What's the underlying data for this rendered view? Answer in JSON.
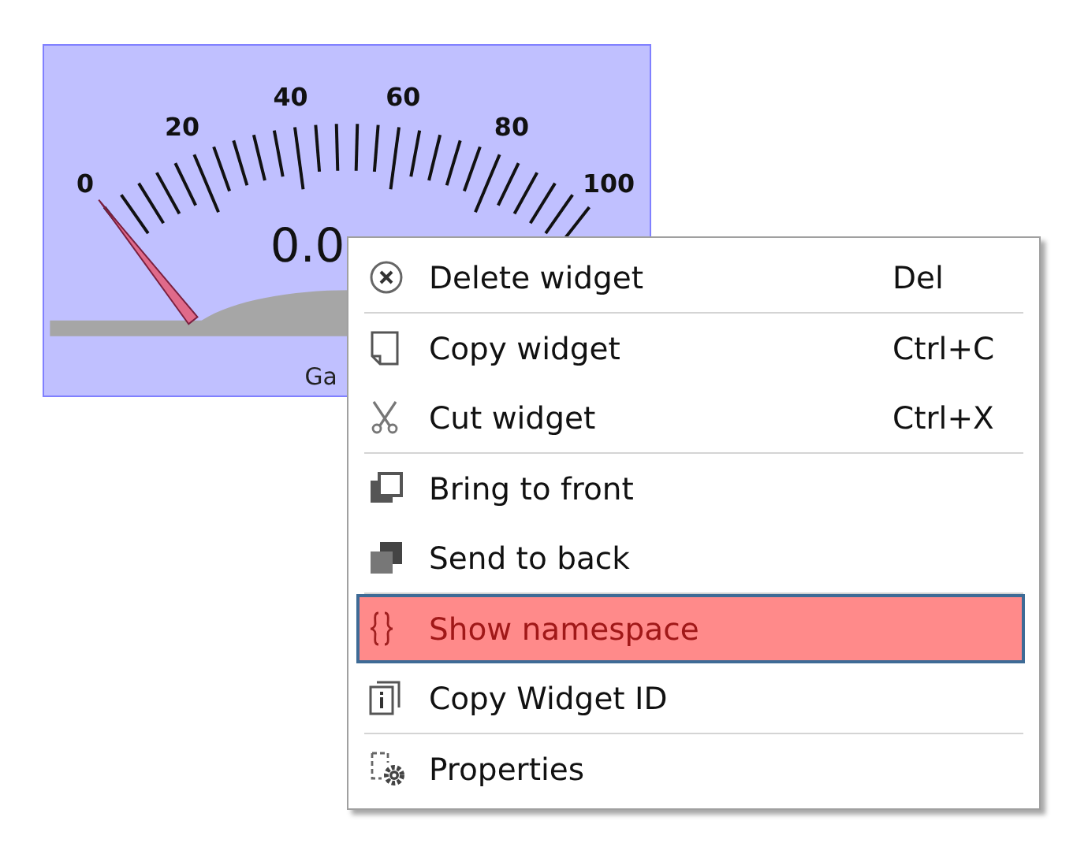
{
  "gauge": {
    "scale_labels": [
      "0",
      "20",
      "40",
      "60",
      "80",
      "100"
    ],
    "value": "0.0",
    "label": "Ga"
  },
  "context_menu": {
    "items": [
      {
        "kind": "item",
        "label": "Delete widget",
        "shortcut": "Del",
        "selected": false
      },
      {
        "kind": "separator"
      },
      {
        "kind": "item",
        "label": "Copy widget",
        "shortcut": "Ctrl+C",
        "selected": false
      },
      {
        "kind": "item",
        "label": "Cut widget",
        "shortcut": "Ctrl+X",
        "selected": false
      },
      {
        "kind": "separator"
      },
      {
        "kind": "item",
        "label": "Bring to front",
        "selected": false
      },
      {
        "kind": "item",
        "label": "Send to back",
        "selected": false
      },
      {
        "kind": "separator"
      },
      {
        "kind": "item",
        "label": "Show namespace",
        "selected": true
      },
      {
        "kind": "item",
        "label": "Copy Widget ID",
        "selected": false
      },
      {
        "kind": "separator"
      },
      {
        "kind": "item",
        "label": "Properties",
        "selected": false
      }
    ]
  }
}
